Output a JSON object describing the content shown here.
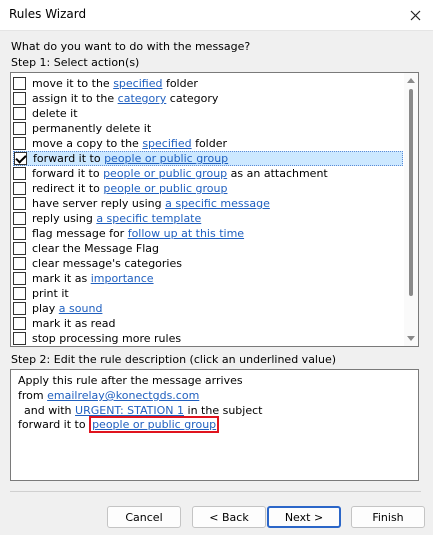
{
  "window": {
    "title": "Rules Wizard"
  },
  "prompt": "What do you want to do with the message?",
  "step1": {
    "label": "Step 1: Select action(s)",
    "actions": [
      {
        "checked": false,
        "parts": [
          "move it to the ",
          "specified",
          " folder"
        ]
      },
      {
        "checked": false,
        "parts": [
          "assign it to the ",
          "category",
          " category"
        ]
      },
      {
        "checked": false,
        "parts": [
          "delete it"
        ]
      },
      {
        "checked": false,
        "parts": [
          "permanently delete it"
        ]
      },
      {
        "checked": false,
        "parts": [
          "move a copy to the ",
          "specified",
          " folder"
        ]
      },
      {
        "checked": true,
        "parts": [
          "forward it to ",
          "people or public group"
        ]
      },
      {
        "checked": false,
        "parts": [
          "forward it to ",
          "people or public group",
          " as an attachment"
        ]
      },
      {
        "checked": false,
        "parts": [
          "redirect it to ",
          "people or public group"
        ]
      },
      {
        "checked": false,
        "parts": [
          "have server reply using ",
          "a specific message"
        ]
      },
      {
        "checked": false,
        "parts": [
          "reply using ",
          "a specific template"
        ]
      },
      {
        "checked": false,
        "parts": [
          "flag message for ",
          "follow up at this time"
        ]
      },
      {
        "checked": false,
        "parts": [
          "clear the Message Flag"
        ]
      },
      {
        "checked": false,
        "parts": [
          "clear message's categories"
        ]
      },
      {
        "checked": false,
        "parts": [
          "mark it as ",
          "importance"
        ]
      },
      {
        "checked": false,
        "parts": [
          "print it"
        ]
      },
      {
        "checked": false,
        "parts": [
          "play ",
          "a sound"
        ]
      },
      {
        "checked": false,
        "parts": [
          "mark it as read"
        ]
      },
      {
        "checked": false,
        "parts": [
          "stop processing more rules"
        ]
      }
    ]
  },
  "step2": {
    "label": "Step 2: Edit the rule description (click an underlined value)",
    "line1": "Apply this rule after the message arrives",
    "line2_text": "from ",
    "line2_link": "emailrelay@konectgds.com",
    "line3_text": "and with ",
    "line3_link": "URGENT: STATION 1",
    "line3_after": " in the subject",
    "line4_text": "forward it to ",
    "line4_link": "people or public group"
  },
  "buttons": {
    "cancel": "Cancel",
    "back": "< Back",
    "next": "Next >",
    "finish": "Finish"
  },
  "colors": {
    "link": "#1f5fbf",
    "highlight": "#e0141e",
    "selection": "#cce8ff"
  }
}
